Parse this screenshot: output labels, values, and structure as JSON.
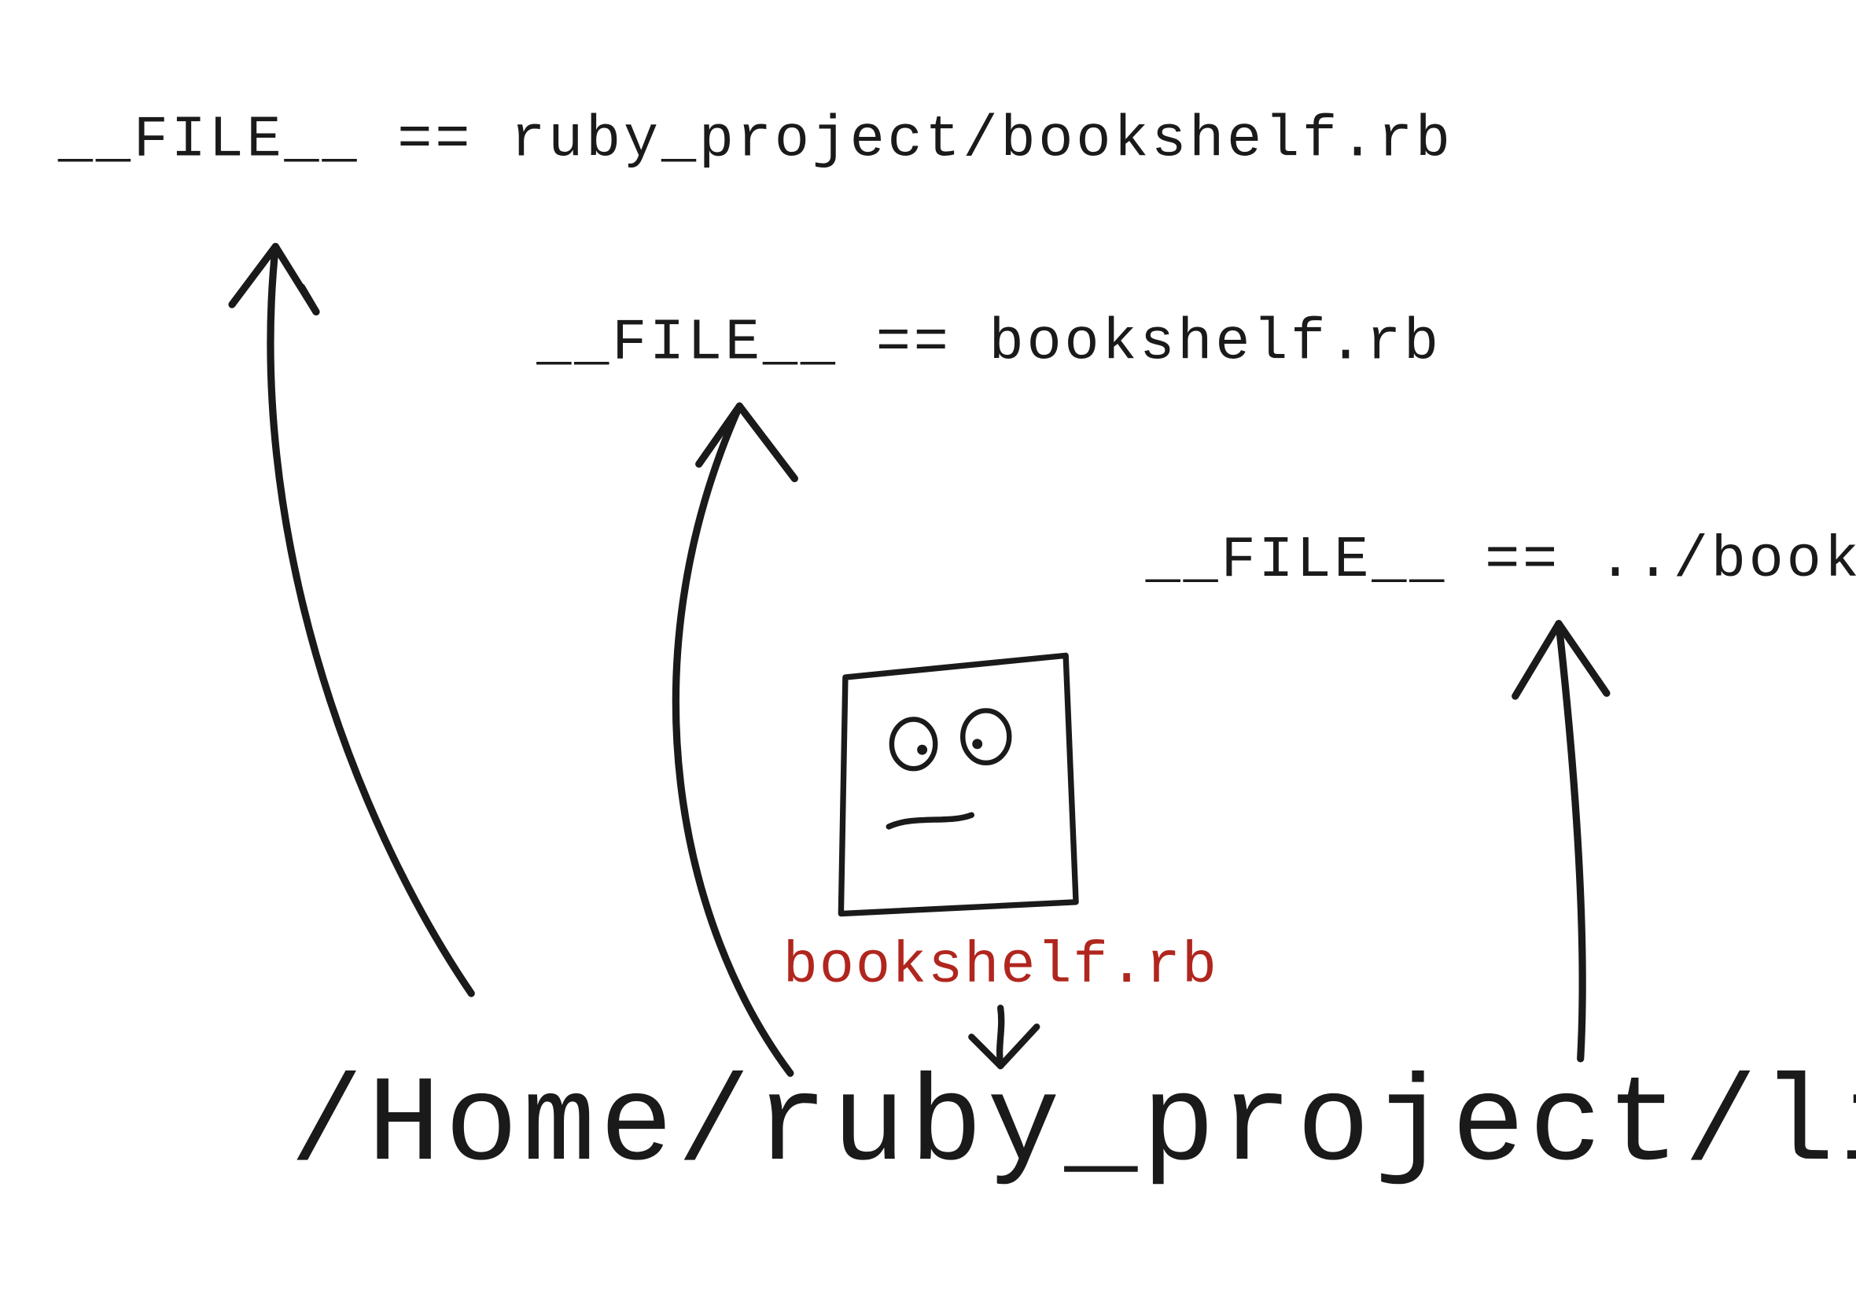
{
  "labels": {
    "top": "__FILE__ == ruby_project/bookshelf.rb",
    "mid": "__FILE__  == bookshelf.rb",
    "right": "__FILE__  == ../bookshelf.rb",
    "file": "bookshelf.rb",
    "path": "/Home/ruby_project/lib"
  },
  "colors": {
    "ink": "#1a1a1a",
    "red": "#b0261e"
  }
}
